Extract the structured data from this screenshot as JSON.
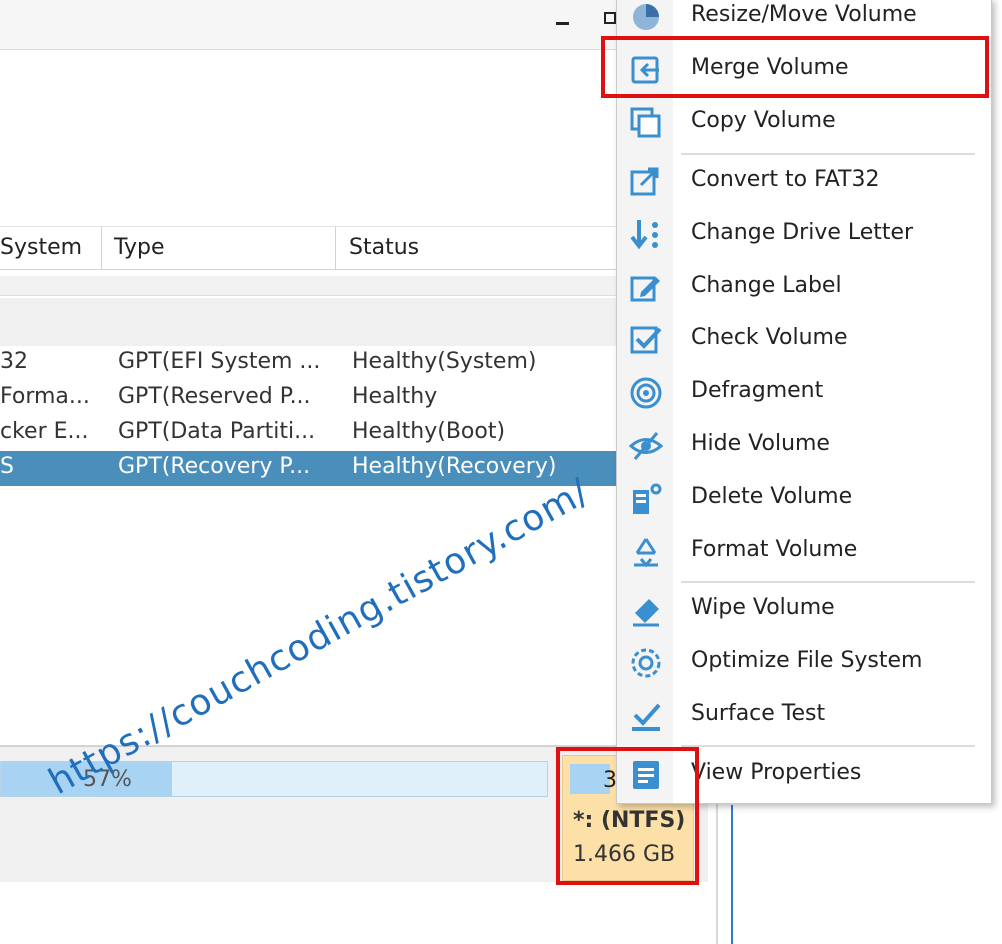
{
  "window": {
    "minimize_glyph": "",
    "maximize_glyph": ""
  },
  "table": {
    "columns": [
      "System",
      "Type",
      "Status"
    ],
    "rows": [
      {
        "fs": "32",
        "type": "GPT(EFI System ...",
        "status": "Healthy(System)"
      },
      {
        "fs": "Forma...",
        "type": "GPT(Reserved P...",
        "status": "Healthy"
      },
      {
        "fs": "cker E...",
        "type": "GPT(Data Partiti...",
        "status": "Healthy(Boot)"
      },
      {
        "fs": "S",
        "type": "GPT(Recovery P...",
        "status": "Healthy(Recovery)"
      }
    ],
    "selected_row": 3
  },
  "disk": {
    "usage_label": "57%",
    "usage_fraction": 0.57,
    "partition_number": "3",
    "partition_name": "*: (NTFS)",
    "partition_size": "1.466 GB"
  },
  "watermark": "https://couchcoding.tistory.com/",
  "context_menu": {
    "items": [
      {
        "label": "Resize/Move Volume",
        "icon": "pie-chart-icon"
      },
      {
        "label": "Merge Volume",
        "icon": "merge-icon"
      },
      {
        "label": "Copy Volume",
        "icon": "copy-icon"
      },
      {
        "label": "Convert to FAT32",
        "icon": "convert-icon"
      },
      {
        "label": "Change Drive Letter",
        "icon": "drive-letter-icon"
      },
      {
        "label": "Change Label",
        "icon": "edit-label-icon"
      },
      {
        "label": "Check Volume",
        "icon": "check-volume-icon"
      },
      {
        "label": "Defragment",
        "icon": "defragment-icon"
      },
      {
        "label": "Hide Volume",
        "icon": "hide-eye-icon"
      },
      {
        "label": "Delete Volume",
        "icon": "delete-icon"
      },
      {
        "label": "Format Volume",
        "icon": "format-recycle-icon"
      },
      {
        "label": "Wipe Volume",
        "icon": "eraser-icon"
      },
      {
        "label": "Optimize File System",
        "icon": "optimize-gear-icon"
      },
      {
        "label": "Surface Test",
        "icon": "surface-test-icon"
      },
      {
        "label": "View Properties",
        "icon": "properties-icon"
      }
    ]
  },
  "colors": {
    "accent": "#4a8fbb",
    "icon_blue": "#3a8fd0",
    "highlight_red": "#e01010",
    "partition_fill": "#fde0a8"
  }
}
